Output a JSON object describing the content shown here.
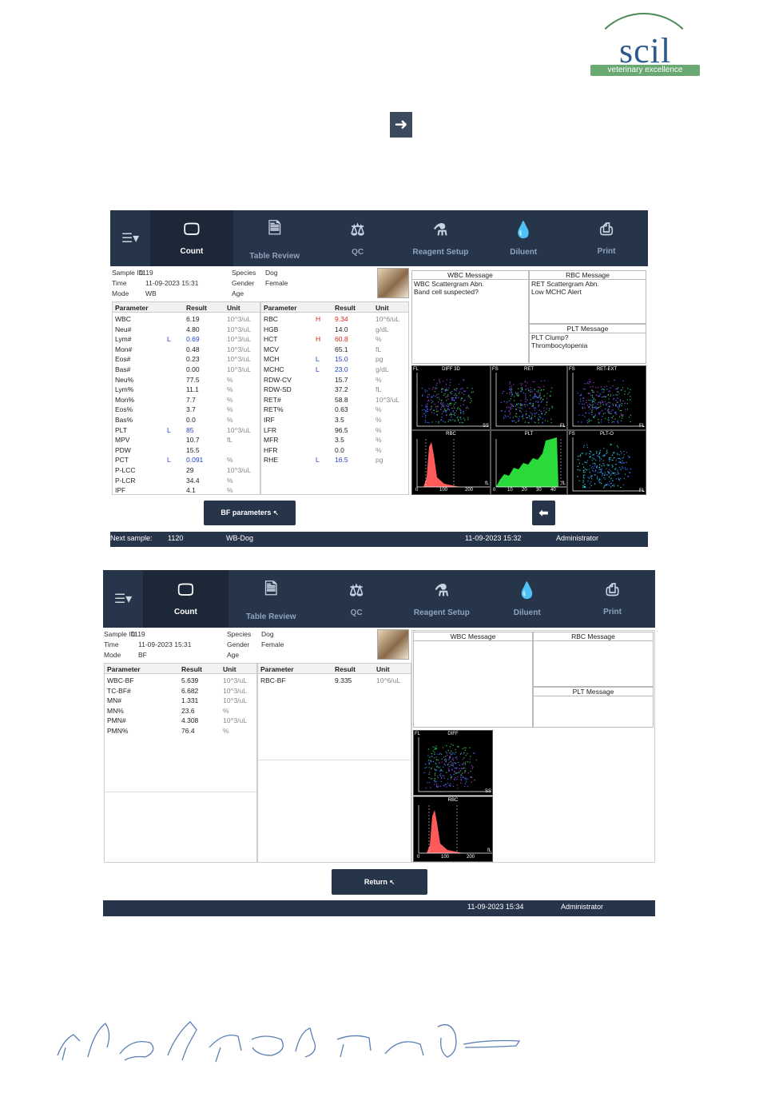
{
  "logo": {
    "brand": "scil",
    "tagline": "veterinary excellence"
  },
  "colors": {
    "topbar": "#27354a",
    "flag_high": "#d8281e",
    "flag_low": "#2243c9",
    "logo_green": "#6aa871",
    "logo_blue": "#2c5a8e"
  },
  "next_icon": "right-arrow-icon",
  "screen1": {
    "toolbar": [
      {
        "label": "Count",
        "icon": "monitor-icon",
        "active": true
      },
      {
        "label": "Table Review",
        "icon": "document-clock-icon",
        "active": false
      },
      {
        "label": "QC",
        "icon": "balance-scale-icon",
        "active": false
      },
      {
        "label": "Reagent Setup",
        "icon": "reagent-bottle-icon",
        "active": false
      },
      {
        "label": "Diluent",
        "icon": "drop-plus-icon",
        "active": false
      },
      {
        "label": "Print",
        "icon": "printer-icon",
        "active": false
      }
    ],
    "sample": {
      "id_label": "Sample ID",
      "id": "1119",
      "time_label": "Time",
      "time": "11-09-2023 15:31",
      "mode_label": "Mode",
      "mode": "WB",
      "species_label": "Species",
      "species": "Dog",
      "gender_label": "Gender",
      "gender": "Female",
      "age_label": "Age",
      "age": ""
    },
    "headers": {
      "parameter": "Parameter",
      "result": "Result",
      "unit": "Unit"
    },
    "left_rows": [
      {
        "p": "WBC",
        "f": "",
        "r": "6.19",
        "u": "10^3/uL"
      },
      {
        "p": "Neu#",
        "f": "",
        "r": "4.80",
        "u": "10^3/uL"
      },
      {
        "p": "Lym#",
        "f": "L",
        "r": "0.69",
        "u": "10^3/uL"
      },
      {
        "p": "Mon#",
        "f": "",
        "r": "0.48",
        "u": "10^3/uL"
      },
      {
        "p": "Eos#",
        "f": "",
        "r": "0.23",
        "u": "10^3/uL"
      },
      {
        "p": "Bas#",
        "f": "",
        "r": "0.00",
        "u": "10^3/uL"
      },
      {
        "p": "Neu%",
        "f": "",
        "r": "77.5",
        "u": "%"
      },
      {
        "p": "Lym%",
        "f": "",
        "r": "11.1",
        "u": "%"
      },
      {
        "p": "Mon%",
        "f": "",
        "r": "7.7",
        "u": "%"
      },
      {
        "p": "Eos%",
        "f": "",
        "r": "3.7",
        "u": "%"
      },
      {
        "p": "Bas%",
        "f": "",
        "r": "0.0",
        "u": "%"
      },
      {
        "p": "PLT",
        "f": "L",
        "r": "85",
        "u": "10^3/uL"
      },
      {
        "p": "MPV",
        "f": "",
        "r": "10.7",
        "u": "fL"
      },
      {
        "p": "PDW",
        "f": "",
        "r": "15.5",
        "u": ""
      },
      {
        "p": "PCT",
        "f": "L",
        "r": "0.091",
        "u": "%"
      },
      {
        "p": "P-LCC",
        "f": "",
        "r": "29",
        "u": "10^3/uL"
      },
      {
        "p": "P-LCR",
        "f": "",
        "r": "34.4",
        "u": "%"
      },
      {
        "p": "IPF",
        "f": "",
        "r": "4.1",
        "u": "%"
      }
    ],
    "right_rows": [
      {
        "p": "RBC",
        "f": "H",
        "r": "9.34",
        "u": "10^6/uL"
      },
      {
        "p": "HGB",
        "f": "",
        "r": "14.0",
        "u": "g/dL"
      },
      {
        "p": "HCT",
        "f": "H",
        "r": "60.8",
        "u": "%"
      },
      {
        "p": "MCV",
        "f": "",
        "r": "65.1",
        "u": "fL"
      },
      {
        "p": "MCH",
        "f": "L",
        "r": "15.0",
        "u": "pg"
      },
      {
        "p": "MCHC",
        "f": "L",
        "r": "23.0",
        "u": "g/dL"
      },
      {
        "p": "RDW-CV",
        "f": "",
        "r": "15.7",
        "u": "%"
      },
      {
        "p": "RDW-SD",
        "f": "",
        "r": "37.2",
        "u": "fL"
      },
      {
        "p": "RET#",
        "f": "",
        "r": "58.8",
        "u": "10^3/uL"
      },
      {
        "p": "RET%",
        "f": "",
        "r": "0.63",
        "u": "%"
      },
      {
        "p": "IRF",
        "f": "",
        "r": "3.5",
        "u": "%"
      },
      {
        "p": "LFR",
        "f": "",
        "r": "96.5",
        "u": "%"
      },
      {
        "p": "MFR",
        "f": "",
        "r": "3.5",
        "u": "%"
      },
      {
        "p": "HFR",
        "f": "",
        "r": "0.0",
        "u": "%"
      },
      {
        "p": "RHE",
        "f": "L",
        "r": "16.5",
        "u": "pg"
      }
    ],
    "messages": {
      "wbc_title": "WBC Message",
      "wbc_lines": [
        "WBC Scattergram Abn.",
        "Band cell suspected?"
      ],
      "rbc_title": "RBC Message",
      "rbc_lines": [
        "RET Scattergram Abn.",
        "Low MCHC Alert"
      ],
      "plt_title": "PLT Message",
      "plt_lines": [
        "PLT Clump?",
        "Thrombocytopenia"
      ]
    },
    "plots": [
      {
        "name": "DIFF 3D",
        "type": "scatter",
        "y": "FL",
        "x": "SS"
      },
      {
        "name": "RET",
        "type": "scatter",
        "y": "FS",
        "x": "FL"
      },
      {
        "name": "RET-EXT",
        "type": "scatter",
        "y": "FS",
        "x": "FL"
      },
      {
        "name": "RBC",
        "type": "histogram",
        "ticks": [
          "0",
          "100",
          "200"
        ],
        "x": "fL"
      },
      {
        "name": "PLT",
        "type": "histogram",
        "ticks": [
          "0",
          "10",
          "20",
          "30",
          "40"
        ],
        "x": "fL"
      },
      {
        "name": "PLT-O",
        "type": "scatter",
        "y": "FS",
        "x": "FL"
      }
    ],
    "bf_button": "BF parameters",
    "back_icon": "left-arrow-icon",
    "status": {
      "next_label": "Next sample:",
      "next_id": "1120",
      "next_mode": "WB-Dog",
      "datetime": "11-09-2023 15:32",
      "user": "Administrator"
    }
  },
  "screen2": {
    "toolbar": [
      {
        "label": "Count",
        "icon": "monitor-icon",
        "active": true
      },
      {
        "label": "Table Review",
        "icon": "document-clock-icon",
        "active": false
      },
      {
        "label": "QC",
        "icon": "balance-scale-icon",
        "active": false
      },
      {
        "label": "Reagent Setup",
        "icon": "reagent-bottle-icon",
        "active": false
      },
      {
        "label": "Diluent",
        "icon": "drop-plus-icon",
        "active": false
      },
      {
        "label": "Print",
        "icon": "printer-icon",
        "active": false
      }
    ],
    "sample": {
      "id_label": "Sample ID",
      "id": "1119",
      "time_label": "Time",
      "time": "11-09-2023 15:31",
      "mode_label": "Mode",
      "mode": "BF",
      "species_label": "Species",
      "species": "Dog",
      "gender_label": "Gender",
      "gender": "Female",
      "age_label": "Age",
      "age": ""
    },
    "headers": {
      "parameter": "Parameter",
      "result": "Result",
      "unit": "Unit"
    },
    "left_rows": [
      {
        "p": "WBC-BF",
        "r": "5.639",
        "u": "10^3/uL"
      },
      {
        "p": "TC-BF#",
        "r": "6.682",
        "u": "10^3/uL"
      },
      {
        "p": "MN#",
        "r": "1.331",
        "u": "10^3/uL"
      },
      {
        "p": "MN%",
        "r": "23.6",
        "u": "%"
      },
      {
        "p": "PMN#",
        "r": "4.308",
        "u": "10^3/uL"
      },
      {
        "p": "PMN%",
        "r": "76.4",
        "u": "%"
      }
    ],
    "right_rows": [
      {
        "p": "RBC-BF",
        "r": "9.335",
        "u": "10^6/uL"
      }
    ],
    "messages": {
      "wbc_title": "WBC Message",
      "rbc_title": "RBC Message",
      "plt_title": "PLT Message"
    },
    "plots": [
      {
        "name": "DIFF",
        "type": "scatter",
        "y": "FL",
        "x": "SS"
      },
      {
        "name": "RBC",
        "type": "histogram",
        "ticks": [
          "0",
          "100",
          "200"
        ],
        "x": "fL"
      }
    ],
    "return_button": "Return",
    "status": {
      "datetime": "11-09-2023 15:34",
      "user": "Administrator"
    }
  }
}
